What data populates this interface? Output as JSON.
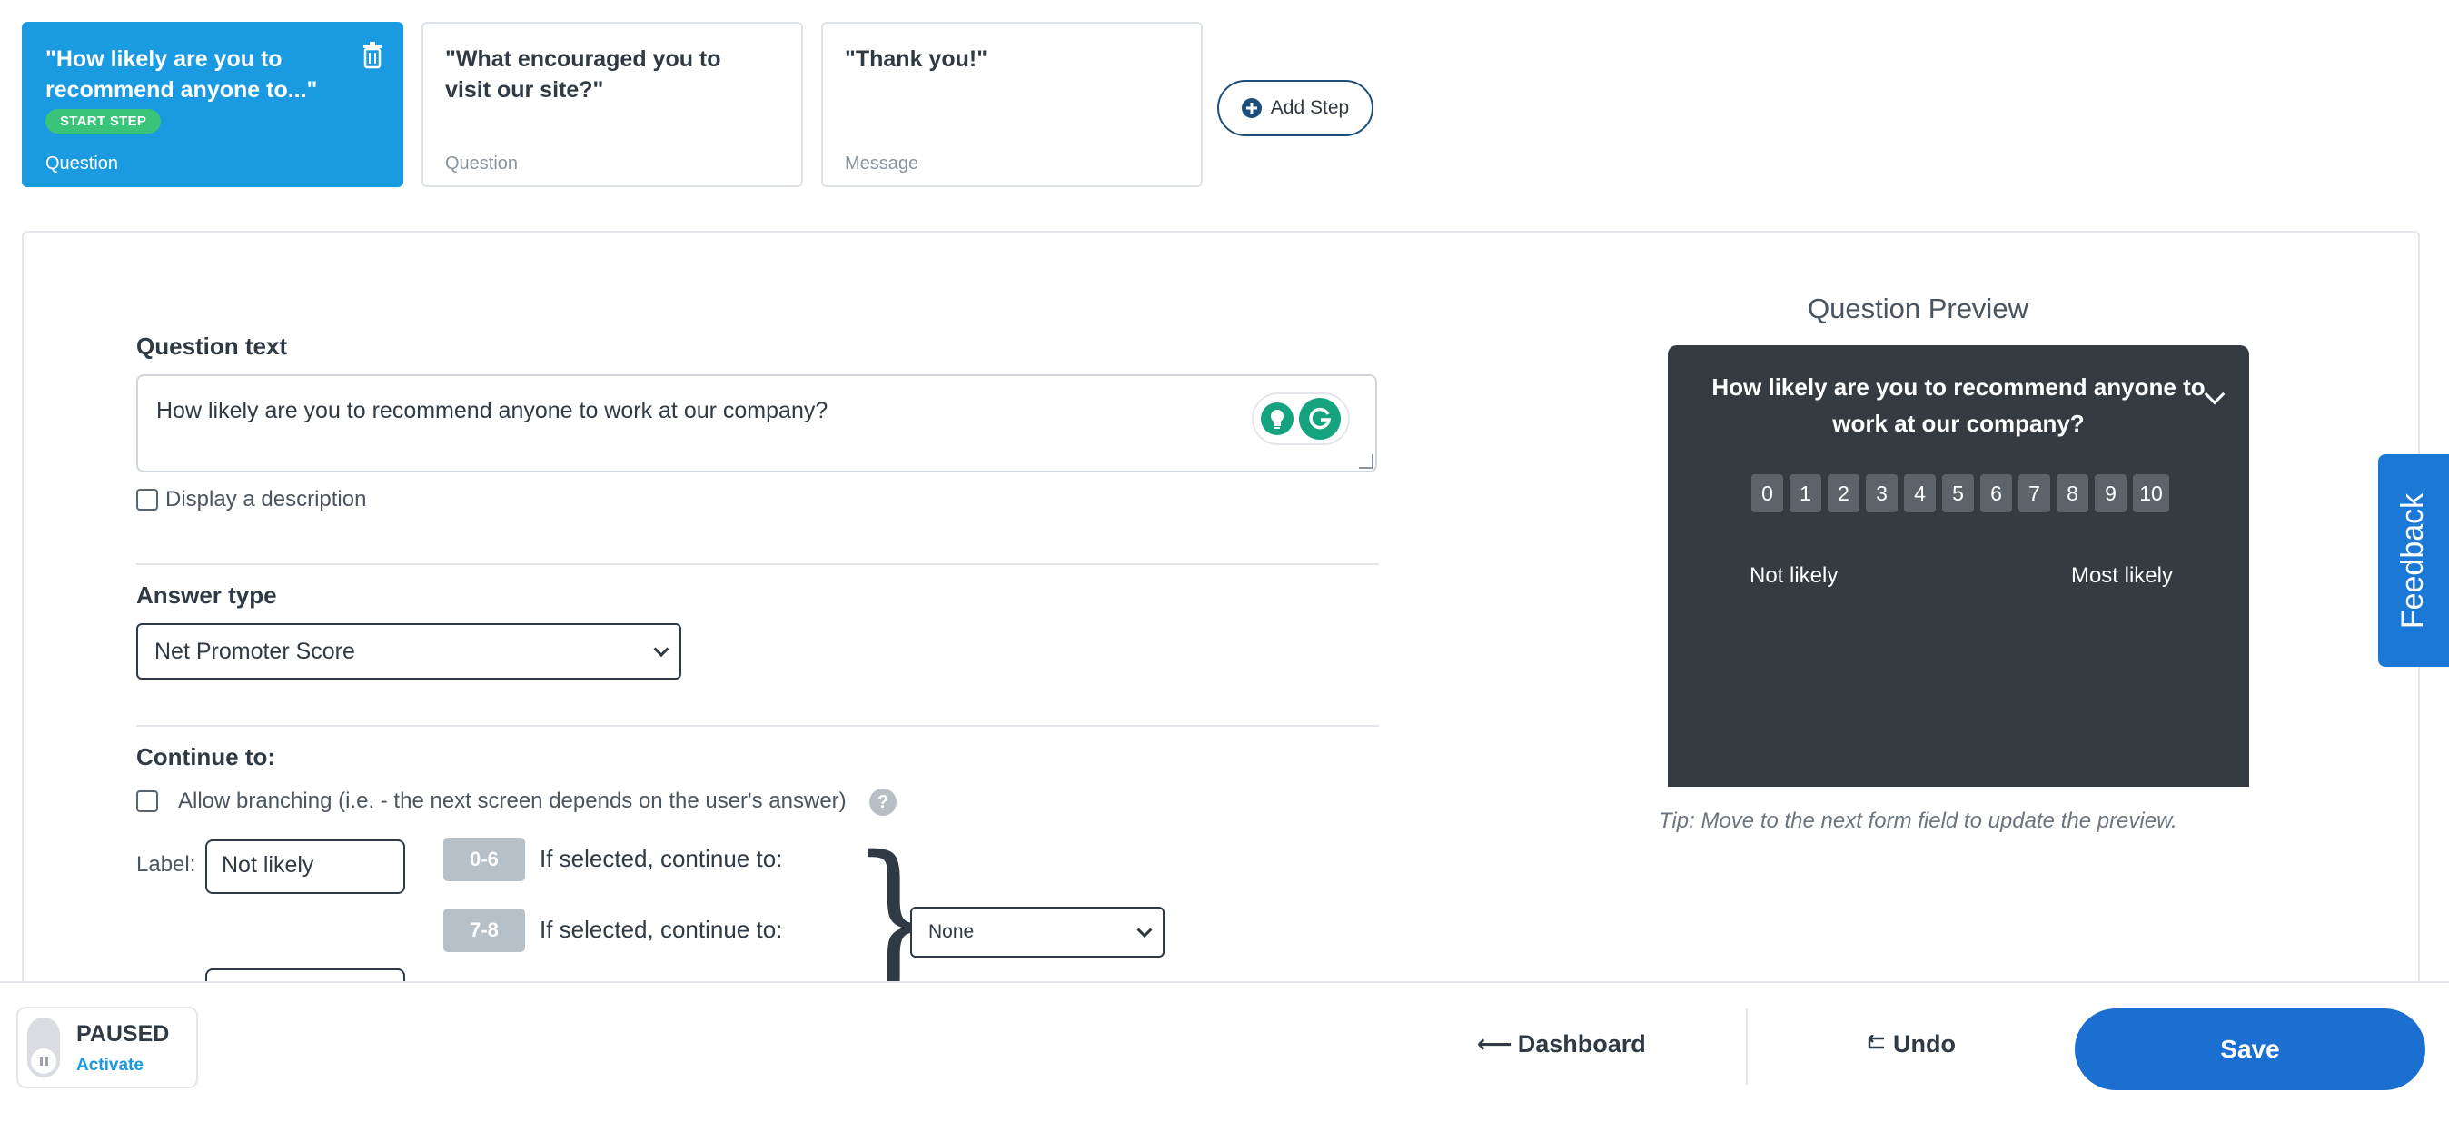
{
  "steps": [
    {
      "title": "\"How likely are you to recommend anyone to...\"",
      "badge": "START STEP",
      "kind": "Question"
    },
    {
      "title": "\"What encouraged you to visit our site?\"",
      "kind": "Question"
    },
    {
      "title": "\"Thank you!\"",
      "kind": "Message"
    }
  ],
  "add_step_label": "Add Step",
  "editor": {
    "question_text_label": "Question text",
    "question_text_value": "How likely are you to recommend anyone to work at our company?",
    "display_description_label": "Display a description",
    "answer_type_label": "Answer type",
    "answer_type_value": "Net Promoter Score",
    "continue_label": "Continue to:",
    "allow_branching_label": "Allow branching (i.e. - the next screen depends on the user's answer)",
    "help_glyph": "?",
    "label_caption": "Label:",
    "label_value_1": "Not likely",
    "ranges": [
      {
        "range": "0-6",
        "text": "If selected, continue to:"
      },
      {
        "range": "7-8",
        "text": "If selected, continue to:"
      }
    ],
    "continue_target_value": "None"
  },
  "preview": {
    "title": "Question Preview",
    "question": "How likely are you to recommend anyone to work at our company?",
    "scale": [
      "0",
      "1",
      "2",
      "3",
      "4",
      "5",
      "6",
      "7",
      "8",
      "9",
      "10"
    ],
    "low_label": "Not likely",
    "high_label": "Most likely",
    "tip": "Tip: Move to the next form field to update the preview."
  },
  "feedback_label": "Feedback",
  "footer": {
    "status": "PAUSED",
    "status_action": "Activate",
    "dashboard_label": "Dashboard",
    "undo_label": "Undo",
    "save_label": "Save"
  },
  "colors": {
    "accent": "#1a9ae0",
    "save": "#1b6fd1",
    "start_badge": "#39c47a",
    "preview_bg": "#363b42"
  }
}
